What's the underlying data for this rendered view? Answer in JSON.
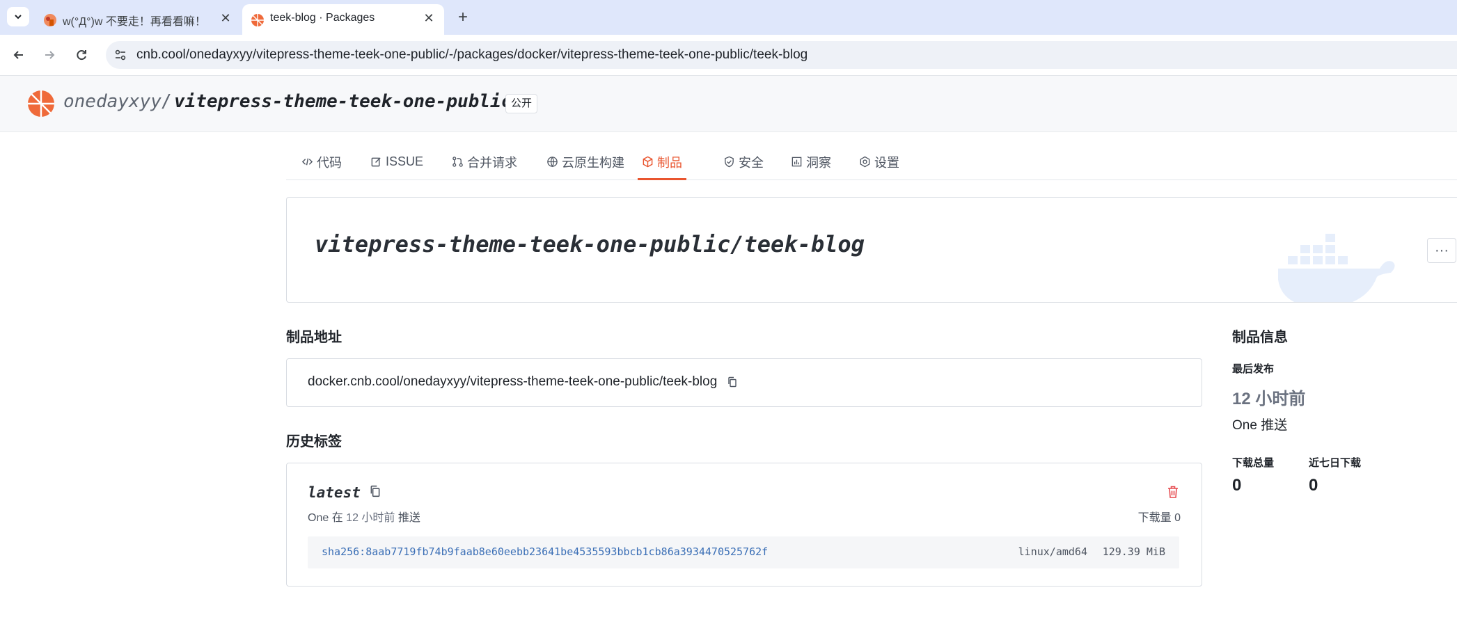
{
  "browser": {
    "tabs": [
      {
        "title": "w(°Д°)w 不要走！再看看嘛！",
        "active": false
      },
      {
        "title": "teek-blog · Packages",
        "active": true
      }
    ],
    "url": "cnb.cool/onedayxyy/vitepress-theme-teek-one-public/-/packages/docker/vitepress-theme-teek-one-public/teek-blog"
  },
  "repo": {
    "owner": "onedayxyy",
    "separator": "/",
    "name": "vitepress-theme-teek-one-public",
    "visibility": "公开"
  },
  "nav": {
    "tabs": [
      {
        "label": "代码",
        "icon": "code-icon"
      },
      {
        "label": "ISSUE",
        "icon": "issue-icon"
      },
      {
        "label": "合并请求",
        "icon": "merge-request-icon"
      },
      {
        "label": "云原生构建",
        "icon": "build-icon"
      },
      {
        "label": "制品",
        "icon": "package-icon",
        "active": true
      },
      {
        "label": "安全",
        "icon": "shield-icon"
      },
      {
        "label": "洞察",
        "icon": "insights-icon"
      },
      {
        "label": "设置",
        "icon": "gear-icon"
      }
    ]
  },
  "package": {
    "title": "vitepress-theme-teek-one-public/teek-blog",
    "more": "···",
    "address_heading": "制品地址",
    "address": "docker.cnb.cool/onedayxyy/vitepress-theme-teek-one-public/teek-blog",
    "tags_heading": "历史标签",
    "tag": {
      "name": "latest",
      "pusher": "One",
      "pushed_in": "在",
      "time": "12 小时前",
      "action": "推送",
      "downloads": "下载量 0",
      "digest": "sha256:8aab7719fb74b9faab8e60eebb23641be4535593bbcb1cb86a3934470525762f",
      "platform": "linux/amd64",
      "size": "129.39 MiB"
    }
  },
  "info": {
    "heading": "制品信息",
    "last_publish_label": "最后发布",
    "last_publish_time": "12 小时前",
    "last_publish_by": "One 推送",
    "total_downloads_label": "下载总量",
    "total_downloads": "0",
    "week_downloads_label": "近七日下载",
    "week_downloads": "0"
  },
  "colors": {
    "accent": "#e9552f",
    "danger": "#e5484d",
    "digest": "#3b6fb6",
    "chrome_tabbar": "#dfe7fb"
  }
}
